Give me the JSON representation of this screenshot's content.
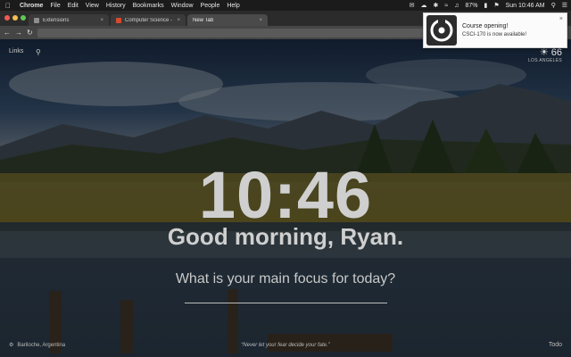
{
  "menubar": {
    "apple": "",
    "items": [
      "Chrome",
      "File",
      "Edit",
      "View",
      "History",
      "Bookmarks",
      "Window",
      "People",
      "Help"
    ],
    "battery": "87%",
    "datetime": "Sun 10:46 AM"
  },
  "tabs": [
    {
      "title": "Extensions",
      "favicon_color": "#8e8e8e"
    },
    {
      "title": "Computer Science - UIUC",
      "favicon_color": "#d64a2a"
    },
    {
      "title": "New Tab",
      "favicon_color": null
    }
  ],
  "newtab": {
    "links_label": "Links",
    "weather_temp": "66",
    "weather_location": "LOS ANGELES",
    "clock": "10:46",
    "greeting": "Good morning, Ryan.",
    "focus_prompt": "What is your main focus for today?",
    "location": "Bariloche, Argentina",
    "quote": "“Never let your fear decide your fate.”",
    "todo": "Todo"
  },
  "notification": {
    "title": "Course opening!",
    "body": "CSCI-170 is now available!",
    "close": "×"
  }
}
